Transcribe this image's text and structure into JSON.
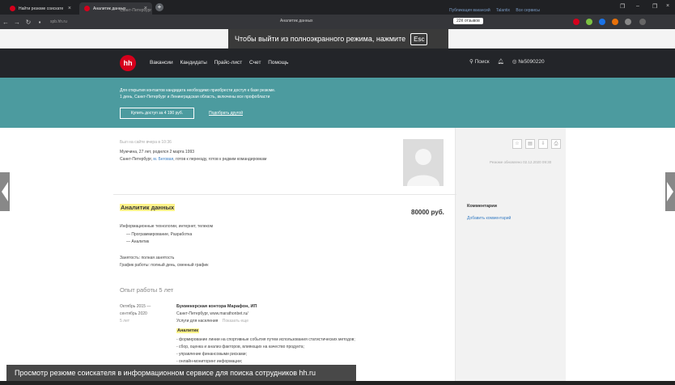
{
  "browser": {
    "tabs": [
      {
        "label": "Найти резюме соискате"
      },
      {
        "label": "Аналитик данных"
      }
    ],
    "url": "spb.hh.ru",
    "page_title": "Аналитик данных",
    "reviews_badge": "22К отзывов"
  },
  "fullscreen_hint": {
    "text": "Чтобы выйти из полноэкранного режима, нажмите",
    "key": "Esc"
  },
  "topbar": {
    "region": "Санкт-Петербург",
    "links": [
      "Публикация вакансий",
      "Talantix",
      "Все сервисы"
    ]
  },
  "header": {
    "logo": "hh",
    "nav": [
      "Вакансии",
      "Кандидаты",
      "Прайс-лист",
      "Счет",
      "Помощь"
    ],
    "search": "Поиск",
    "account": "№5090220"
  },
  "banner": {
    "line1": "Для открытия контактов кандидата необходимо приобрести доступ к базе резюме.",
    "line2": "1 день, Санкт-Петербург и Ленинградская область, включены все профобласти",
    "buy_button": "Купить доступ за 4 190 руб.",
    "other_link": "Подобрать другой"
  },
  "candidate": {
    "last_seen": "Был на сайте вчера в 10:36",
    "info": "Мужчина, 27 лет, родился 2 марта 1993",
    "location_prefix": "Санкт-Петербург,",
    "metro": "м. Беговая",
    "location_suffix": ", готов к переезду, готов к редким командировкам",
    "updated": "Резюме обновлено 02.12.2020 09:30"
  },
  "resume": {
    "title": "Аналитик данных",
    "salary": "80000 руб.",
    "sphere": "Информационные технологии, интернет, телеком",
    "spec1": "— Программирование, Разработка",
    "spec2": "— Аналитик",
    "employment": "Занятость: полная занятость",
    "schedule": "График работы: полный день, сменный график"
  },
  "comments": {
    "title": "Комментарии",
    "add": "Добавить комментарий"
  },
  "experience": {
    "title": "Опыт работы 5 лет",
    "period_start": "Октябрь 2015 —",
    "period_end": "сентябрь 2020",
    "duration": "5 лет",
    "company": "Букмекерская контора Марафон, ИП",
    "company_location": "Санкт-Петербург, www.marathonbet.ru/",
    "industry": "Услуги для населения",
    "show_more": "Показать еще",
    "role": "Аналитик",
    "duties": [
      "- формирование линии на спортивные события путем использования статистических методов;",
      "- сбор, оценка и анализ факторов, влияющих на качество продукта;",
      "- управление финансовыми рисками;",
      "- онлайн-мониторинг информации;"
    ]
  },
  "caption": "Просмотр резюме соискателя в информационном сервисе для поиска сотрудников hh.ru"
}
